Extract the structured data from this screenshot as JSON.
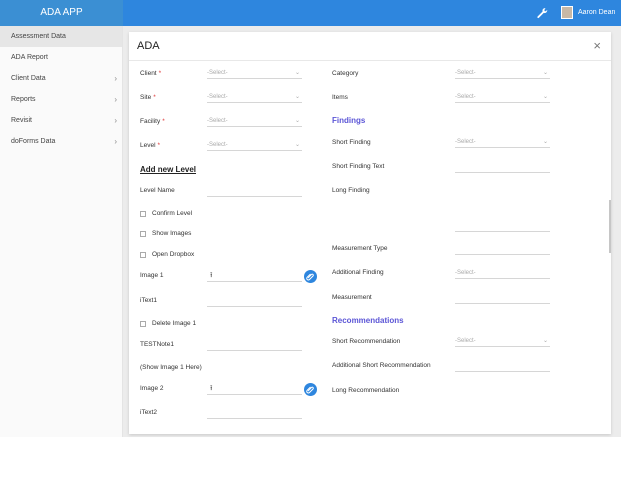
{
  "app": {
    "title": "ADA APP",
    "user_name": "Aaron Dean"
  },
  "sidebar": {
    "items": [
      {
        "label": "Assessment Data",
        "chevron": ""
      },
      {
        "label": "ADA Report",
        "chevron": ""
      },
      {
        "label": "Client Data",
        "chevron": "›"
      },
      {
        "label": "Reports",
        "chevron": "›"
      },
      {
        "label": "Revisit",
        "chevron": "›"
      },
      {
        "label": "doForms Data",
        "chevron": "›"
      }
    ]
  },
  "modal": {
    "title": "ADA",
    "close_glyph": "×",
    "select_placeholder": "-Select-",
    "select_arrow": "⌄",
    "left": {
      "client_label": "Client",
      "site_label": "Site",
      "facility_label": "Facility",
      "level_label": "Level",
      "required_mark": "*",
      "add_new_level": "Add new Level",
      "level_name_label": "Level Name",
      "confirm_level": "Confirm Level",
      "show_images": "Show Images",
      "open_dropbox": "Open Dropbox",
      "image1_label": "Image 1",
      "itext1_label": "iText1",
      "delete_image1": "Delete Image 1",
      "testnote1_label": "TESTNote1",
      "show_image1_here": "(Show Image 1 Here)",
      "image2_label": "Image 2",
      "itext2_label": "iText2"
    },
    "right": {
      "category_label": "Category",
      "items_label": "Items",
      "findings_heading": "Findings",
      "short_finding_label": "Short Finding",
      "short_finding_text_label": "Short Finding Text",
      "long_finding_label": "Long Finding",
      "measurement_type_label": "Measurement Type",
      "additional_finding_label": "Additional Finding",
      "additional_finding_placeholder": "-Select-",
      "measurement_label": "Measurement",
      "recommendations_heading": "Recommendations",
      "short_recommendation_label": "Short Recommendation",
      "additional_short_recommendation_label": "Additional Short Recommendation",
      "long_recommendation_label": "Long Recommendation"
    }
  },
  "colors": {
    "topbar": "#2e86de",
    "sidebar_head": "#3b8fd3",
    "section_heading": "#5b55d6",
    "required": "#dd3333"
  },
  "icons": [
    "wrench-icon",
    "avatar",
    "close-icon",
    "chevron-right-icon",
    "chevron-down-icon",
    "upload-icon",
    "attach-icon",
    "checkbox"
  ]
}
